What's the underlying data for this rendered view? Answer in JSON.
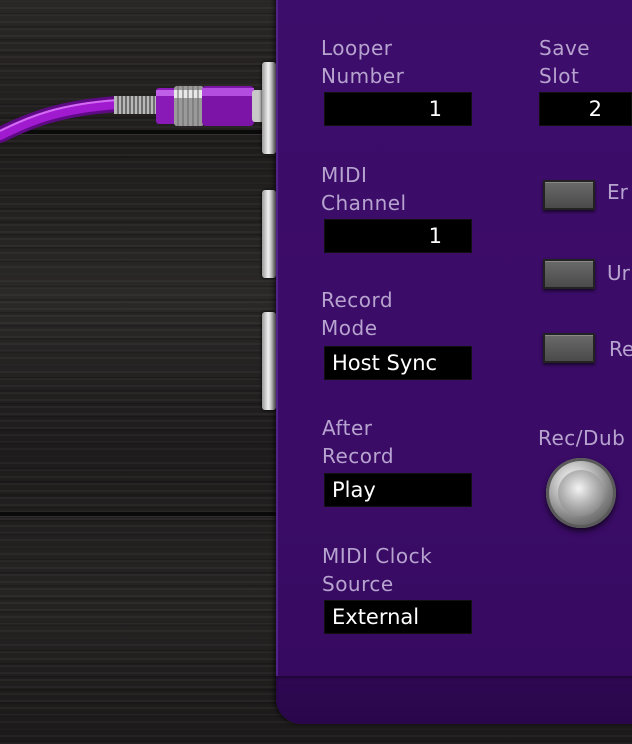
{
  "panel": {
    "looper_number": {
      "label": [
        "Looper",
        "Number"
      ],
      "value": "1"
    },
    "save_slot": {
      "label": [
        "Save",
        "Slot"
      ],
      "value": "2"
    },
    "midi_channel": {
      "label": [
        "MIDI",
        "Channel"
      ],
      "value": "1"
    },
    "record_mode": {
      "label": [
        "Record",
        "Mode"
      ],
      "value": "Host Sync"
    },
    "after_record": {
      "label": [
        "After",
        "Record"
      ],
      "value": "Play"
    },
    "midi_clock_source": {
      "label": [
        "MIDI Clock",
        "Source"
      ],
      "value": "External"
    },
    "buttons": [
      {
        "label": "Er"
      },
      {
        "label": "Ur"
      },
      {
        "label": "Re"
      }
    ],
    "footswitch": {
      "label": "Rec/Dub"
    }
  },
  "colors": {
    "panel_purple": "#3a0c66",
    "label_lavender": "#b7a3cf",
    "cable_purple": "#a01ad0"
  }
}
